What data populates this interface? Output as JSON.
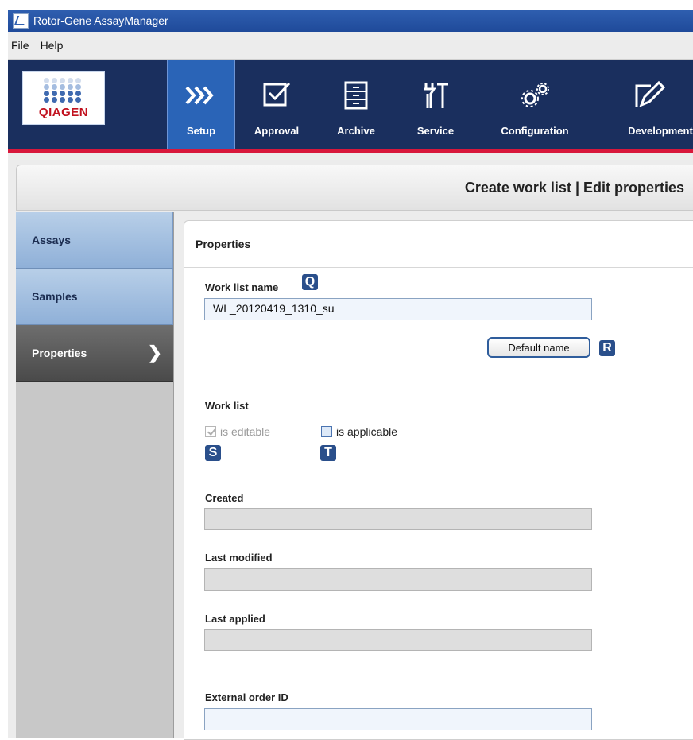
{
  "window": {
    "title": "Rotor-Gene AssayManager"
  },
  "menu": [
    "File",
    "Help"
  ],
  "logo": {
    "brand": "QIAGEN"
  },
  "nav": [
    {
      "label": "Setup",
      "icon": "setup-chevrons-icon",
      "active": true
    },
    {
      "label": "Approval",
      "icon": "approval-check-icon",
      "active": false
    },
    {
      "label": "Archive",
      "icon": "archive-cabinet-icon",
      "active": false
    },
    {
      "label": "Service",
      "icon": "service-tools-icon",
      "active": false
    },
    {
      "label": "Configuration",
      "icon": "configuration-gears-icon",
      "active": false
    },
    {
      "label": "Development",
      "icon": "development-pencil-icon",
      "active": false
    }
  ],
  "breadcrumb": "Create work list | Edit properties",
  "sidebar": [
    {
      "label": "Assays"
    },
    {
      "label": "Samples"
    },
    {
      "label": "Properties",
      "active": true
    }
  ],
  "panel": {
    "title": "Properties",
    "work_list_name": {
      "label": "Work list name",
      "value": "WL_20120419_1310_su",
      "badge": "Q"
    },
    "default_name_button": {
      "label": "Default name",
      "badge": "R"
    },
    "work_list_section": "Work list",
    "is_editable": {
      "label": "is editable",
      "checked": true,
      "disabled": true,
      "badge": "S"
    },
    "is_applicable": {
      "label": "is applicable",
      "checked": false,
      "badge": "T"
    },
    "created": {
      "label": "Created",
      "value": ""
    },
    "last_modified": {
      "label": "Last modified",
      "value": ""
    },
    "last_applied": {
      "label": "Last applied",
      "value": ""
    },
    "external_order_id": {
      "label": "External order ID",
      "value": ""
    }
  }
}
